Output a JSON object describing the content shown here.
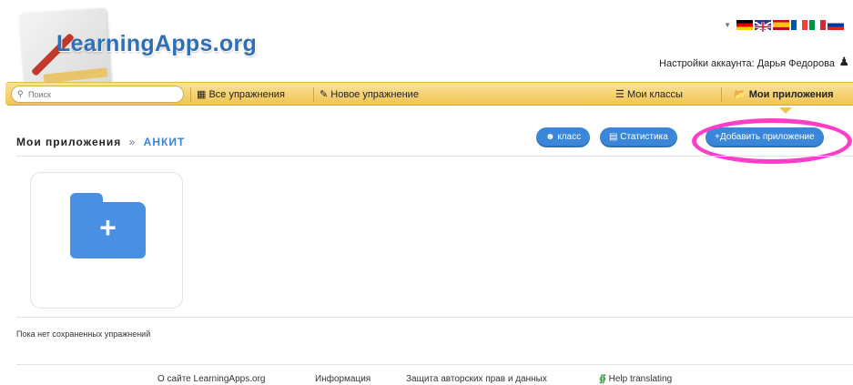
{
  "logo": {
    "text": "LearningApps.org"
  },
  "languages": [
    "de",
    "en",
    "es",
    "fr",
    "it",
    "ru"
  ],
  "account": {
    "text": "Настройки аккаунта: Дарья Федорова"
  },
  "nav": {
    "search_placeholder": "Поиск",
    "all_exercises": "Все упражнения",
    "new_exercise": "Новое упражнение",
    "my_classes": "Мои классы",
    "my_apps": "Мои приложения"
  },
  "breadcrumb": {
    "section": "Мои приложения",
    "separator": "»",
    "class_name": "АНКИТ"
  },
  "actions": {
    "class_label": "класс",
    "stats_label": "Статистика",
    "add_app_label": "Добавить приложение"
  },
  "tile": {
    "icon": "add-folder-icon",
    "plus": "+"
  },
  "empty_text": "Пока нет сохраненных упражнений",
  "footer": {
    "about": "О сайте LearningApps.org",
    "info": "Информация",
    "copyright": "Защита авторских прав и данных",
    "help": "Help translating"
  },
  "colors": {
    "accent": "#3a86d8",
    "nav": "#f0c452",
    "highlight": "#ff3dc7"
  }
}
